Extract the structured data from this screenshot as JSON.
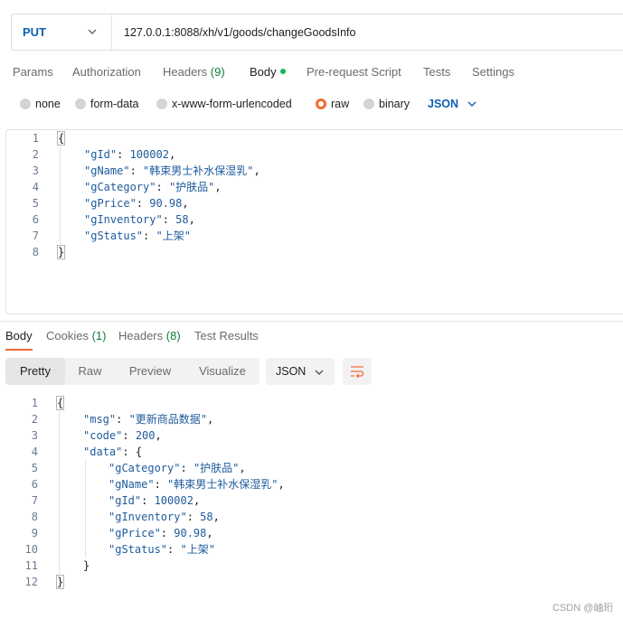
{
  "request": {
    "method": "PUT",
    "url": "127.0.0.1:8088/xh/v1/goods/changeGoodsInfo"
  },
  "request_tabs": [
    {
      "label": "Params"
    },
    {
      "label": "Authorization"
    },
    {
      "label": "Headers",
      "count": "(9)"
    },
    {
      "label": "Body"
    },
    {
      "label": "Pre-request Script"
    },
    {
      "label": "Tests"
    },
    {
      "label": "Settings"
    }
  ],
  "body_types": [
    "none",
    "form-data",
    "x-www-form-urlencoded",
    "raw",
    "binary"
  ],
  "body_format": "JSON",
  "request_body": {
    "line_numbers": [
      "1",
      "2",
      "3",
      "4",
      "5",
      "6",
      "7",
      "8"
    ],
    "open_brace": "{",
    "close_brace": "}",
    "fields": [
      {
        "key": "\"gId\"",
        "value": "100002",
        "type": "number"
      },
      {
        "key": "\"gName\"",
        "value": "\"韩束男士补水保湿乳\"",
        "type": "string"
      },
      {
        "key": "\"gCategory\"",
        "value": "\"护肤品\"",
        "type": "string"
      },
      {
        "key": "\"gPrice\"",
        "value": "90.98",
        "type": "number"
      },
      {
        "key": "\"gInventory\"",
        "value": "58",
        "type": "number"
      },
      {
        "key": "\"gStatus\"",
        "value": "\"上架\"",
        "type": "string"
      }
    ]
  },
  "response_tabs": [
    {
      "label": "Body"
    },
    {
      "label": "Cookies",
      "count": "(1)"
    },
    {
      "label": "Headers",
      "count": "(8)"
    },
    {
      "label": "Test Results"
    }
  ],
  "view_modes": [
    "Pretty",
    "Raw",
    "Preview",
    "Visualize"
  ],
  "response_format": "JSON",
  "response_body": {
    "line_numbers": [
      "1",
      "2",
      "3",
      "4",
      "5",
      "6",
      "7",
      "8",
      "9",
      "10",
      "11",
      "12"
    ],
    "open_brace": "{",
    "close_brace": "}",
    "msg_key": "\"msg\"",
    "msg_value": "\"更新商品数据\"",
    "code_key": "\"code\"",
    "code_value": "200",
    "data_key": "\"data\"",
    "data_open": "{",
    "data_close": "}",
    "data_fields": [
      {
        "key": "\"gCategory\"",
        "value": "\"护肤品\"",
        "type": "string"
      },
      {
        "key": "\"gName\"",
        "value": "\"韩束男士补水保湿乳\"",
        "type": "string"
      },
      {
        "key": "\"gId\"",
        "value": "100002",
        "type": "number"
      },
      {
        "key": "\"gInventory\"",
        "value": "58",
        "type": "number"
      },
      {
        "key": "\"gPrice\"",
        "value": "90.98",
        "type": "number"
      },
      {
        "key": "\"gStatus\"",
        "value": "\"上架\"",
        "type": "string"
      }
    ]
  },
  "watermark": "CSDN @岫珩",
  "colors": {
    "method": "#0b5fb3",
    "accent": "#f26b3a",
    "count": "#0f7d3a",
    "body_dot": "#0cbb52"
  }
}
